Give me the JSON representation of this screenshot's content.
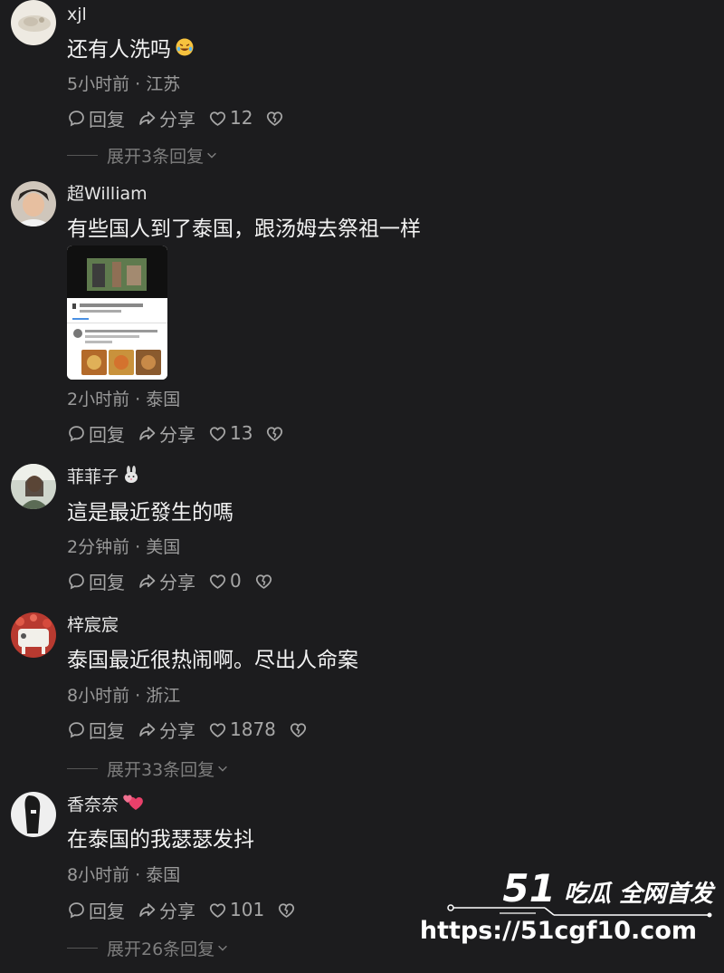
{
  "comments": [
    {
      "username": "xjl",
      "text": "还有人洗吗",
      "time": "5小时前",
      "location": "江苏",
      "reply_label": "回复",
      "share_label": "分享",
      "likes": "12",
      "expand_label": "展开3条回复"
    },
    {
      "username": "超William",
      "text": "有些国人到了泰国，跟汤姆去祭祖一样",
      "time": "2小时前",
      "location": "泰国",
      "reply_label": "回复",
      "share_label": "分享",
      "likes": "13"
    },
    {
      "username": "菲菲子",
      "text": "這是最近發生的嗎",
      "time": "2分钟前",
      "location": "美国",
      "reply_label": "回复",
      "share_label": "分享",
      "likes": "0"
    },
    {
      "username": "梓宸宸",
      "text": "泰国最近很热闹啊。尽出人命案",
      "time": "8小时前",
      "location": "浙江",
      "reply_label": "回复",
      "share_label": "分享",
      "likes": "1878",
      "expand_label": "展开33条回复"
    },
    {
      "username": "香奈奈",
      "text": "在泰国的我瑟瑟发抖",
      "time": "8小时前",
      "location": "泰国",
      "reply_label": "回复",
      "share_label": "分享",
      "likes": "101",
      "expand_label": "展开26条回复"
    }
  ],
  "meta_separator": "·",
  "watermark": {
    "brand_number": "51",
    "brand_text": "吃瓜 全网首发",
    "url": "https://51cgf10.com"
  },
  "colors": {
    "background": "#1c1c1e",
    "text_primary": "#f2f2f2",
    "text_secondary": "#9a9a9a",
    "heart_emoji": "#e8406a"
  },
  "icons": {
    "reply": "speech-bubble-icon",
    "share": "share-arrow-icon",
    "like": "heart-outline-icon",
    "dislike": "broken-heart-icon",
    "expand": "chevron-down-icon"
  }
}
